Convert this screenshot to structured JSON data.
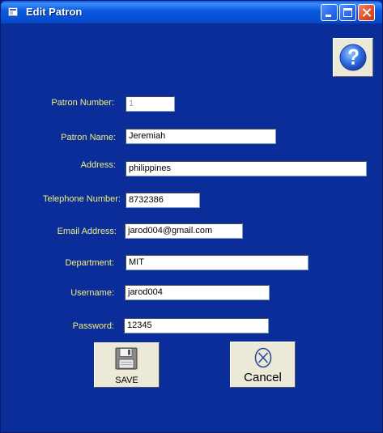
{
  "window": {
    "title": "Edit Patron"
  },
  "form": {
    "patron_number_label": "Patron Number:",
    "patron_number_value": "1",
    "patron_name_label": "Patron Name:",
    "patron_name_value": "Jeremiah",
    "address_label": "Address:",
    "address_value": "philippines",
    "telephone_label": "Telephone Number:",
    "telephone_value": "8732386",
    "email_label": "Email Address:",
    "email_value": "jarod004@gmail.com",
    "department_label": "Department:",
    "department_value": "MIT",
    "username_label": "Username:",
    "username_value": "jarod004",
    "password_label": "Password:",
    "password_value": "12345"
  },
  "buttons": {
    "save_label": "SAVE",
    "cancel_label": "Cancel"
  },
  "colors": {
    "background": "#0a2d9a",
    "label_text": "#f0f07a",
    "titlebar": "#0a58e0"
  }
}
